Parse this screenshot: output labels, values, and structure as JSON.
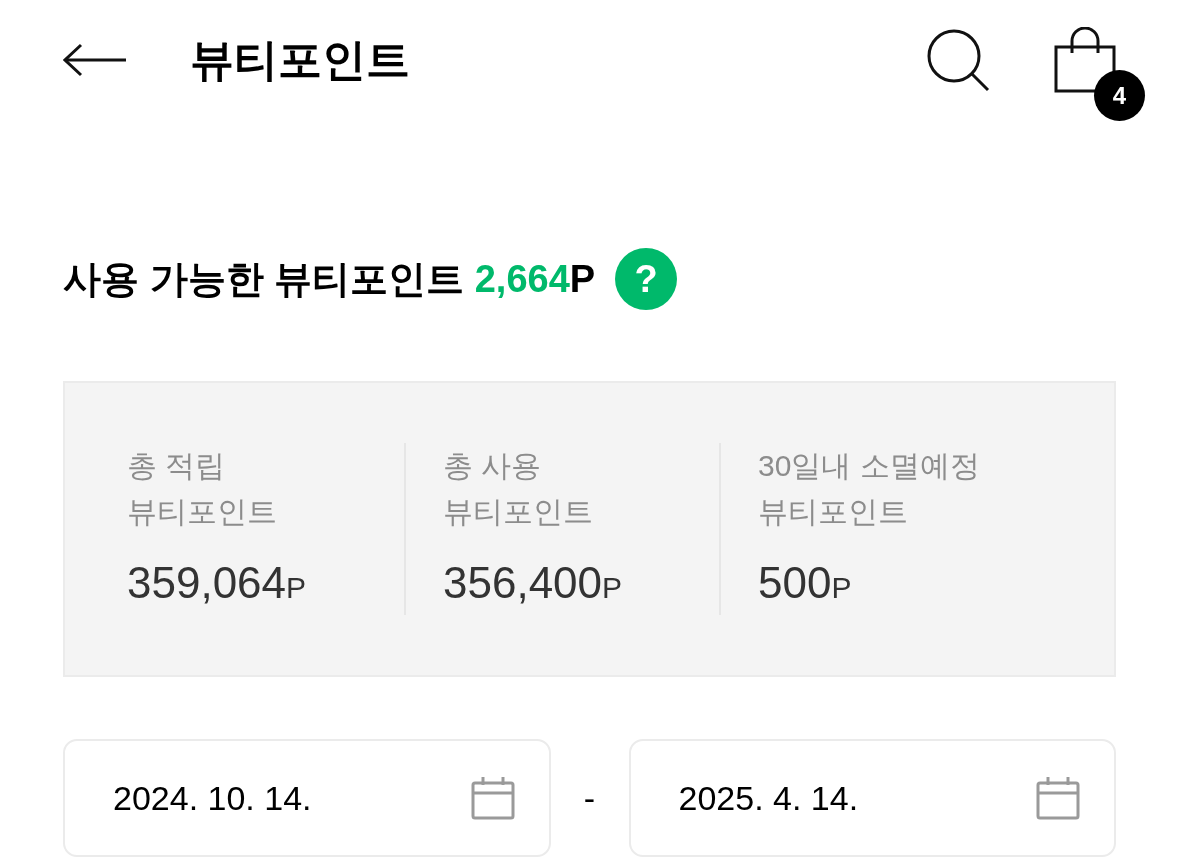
{
  "header": {
    "title": "뷰티포인트",
    "cart_badge": "4"
  },
  "available": {
    "label": "사용 가능한 뷰티포인트",
    "amount": "2,664",
    "unit": "P",
    "help_mark": "?"
  },
  "summary": [
    {
      "label_lines": [
        "총 적립",
        "뷰티포인트"
      ],
      "value": "359,064",
      "unit": "P"
    },
    {
      "label_lines": [
        "총 사용",
        "뷰티포인트"
      ],
      "value": "356,400",
      "unit": "P"
    },
    {
      "label_lines": [
        "30일내 소멸예정",
        "뷰티포인트"
      ],
      "value": "500",
      "unit": "P"
    }
  ],
  "date_range": {
    "start": "2024. 10. 14.",
    "separator": "-",
    "end": "2025. 4. 14."
  }
}
